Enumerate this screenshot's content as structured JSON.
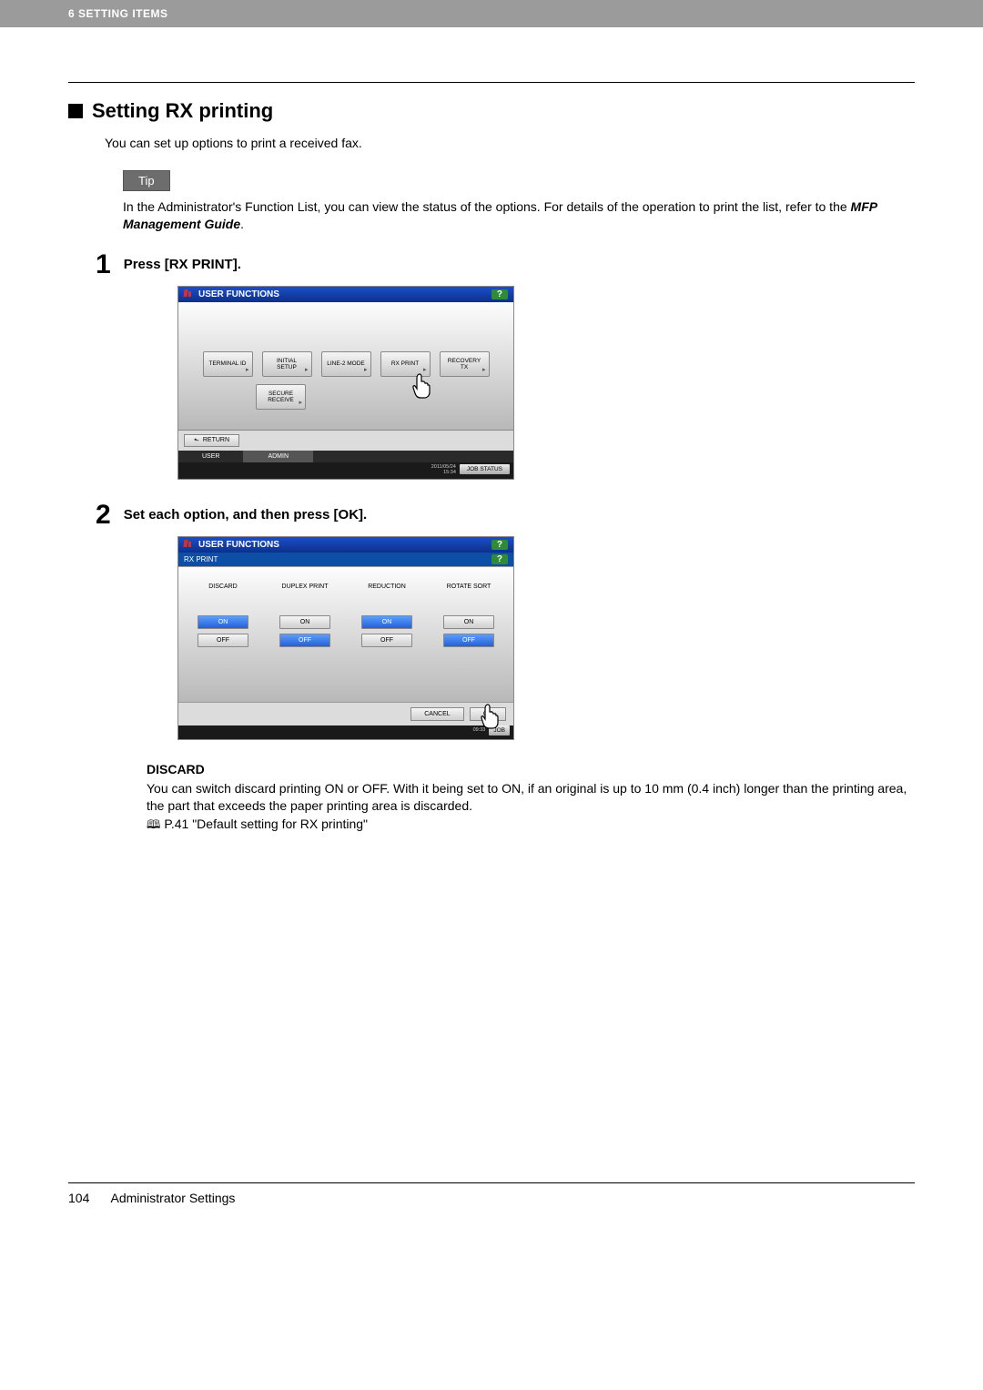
{
  "header": {
    "chapter": "6 SETTING ITEMS"
  },
  "section": {
    "title": "Setting RX printing"
  },
  "intro": "You can set up options to print a received fax.",
  "tip": {
    "label": "Tip",
    "text": "In the Administrator's Function List, you can view the status of the options. For details of the operation to print the list, refer to the ",
    "text_bold": "MFP Management Guide",
    "text_after": "."
  },
  "step1": {
    "num": "1",
    "text": "Press [RX PRINT].",
    "screen": {
      "title": "USER FUNCTIONS",
      "help": "?",
      "buttons": [
        "TERMINAL ID",
        "INITIAL SETUP",
        "LINE-2 MODE",
        "RX PRINT",
        "RECOVERY TX"
      ],
      "button_row2": "SECURE RECEIVE",
      "return": "RETURN",
      "tabs": [
        "USER",
        "ADMIN"
      ],
      "datetime": "2011/05/24\n15:34",
      "job": "JOB STATUS"
    }
  },
  "step2": {
    "num": "2",
    "text": "Set each option, and then press [OK].",
    "screen": {
      "title": "USER FUNCTIONS",
      "subtitle": "RX PRINT",
      "help": "?",
      "cols": [
        {
          "label": "DISCARD",
          "on_selected": true
        },
        {
          "label": "DUPLEX PRINT",
          "on_selected": false
        },
        {
          "label": "REDUCTION",
          "on_selected": true
        },
        {
          "label": "ROTATE SORT",
          "on_selected": false
        }
      ],
      "on": "ON",
      "off": "OFF",
      "cancel": "CANCEL",
      "ok": "OK",
      "datetime": "09:33",
      "job": "JOB"
    }
  },
  "desc": {
    "title": "DISCARD",
    "text": "You can switch discard printing ON or OFF. With it being set to ON, if an original is up to 10 mm (0.4 inch) longer than the printing area, the part that exceeds the paper printing area is discarded.",
    "ref": "P.41 \"Default setting for RX printing\""
  },
  "footer": {
    "page": "104",
    "title": "Administrator Settings"
  }
}
